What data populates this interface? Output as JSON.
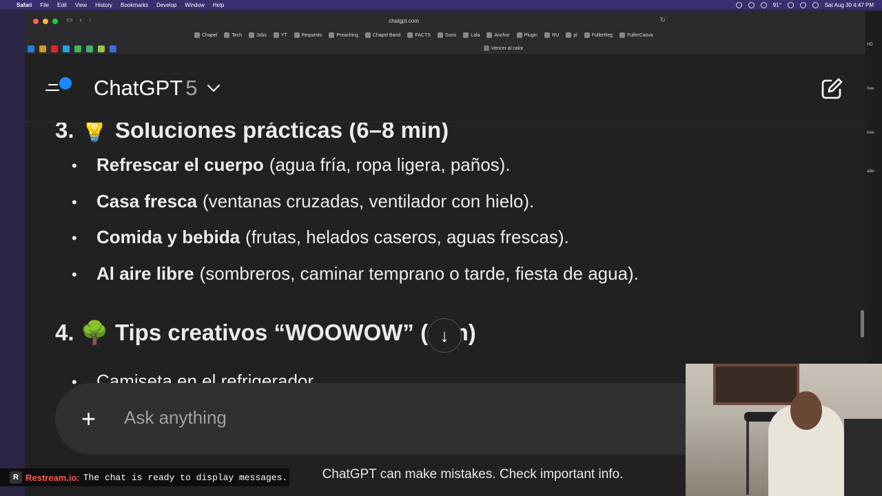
{
  "menubar": {
    "app": "Safari",
    "items": [
      "File",
      "Edit",
      "View",
      "History",
      "Bookmarks",
      "Develop",
      "Window",
      "Help"
    ],
    "temp": "91°",
    "datetime": "Sat Aug 30  4:47 PM"
  },
  "browser": {
    "url": "chatgpt.com",
    "favorites": [
      "Chapel",
      "Tech",
      "Jobs",
      "YT",
      "Requests",
      "Preaching",
      "Chapel Band",
      "FACTS",
      "Suno",
      "Lala",
      "Anchor",
      "Plugin",
      "RU",
      "pl",
      "FullerReg",
      "FullerCanva"
    ],
    "tab_title": "Vencer al calor"
  },
  "header": {
    "model_name": "ChatGPT",
    "model_version": "5",
    "chevron": "chevron-down-icon"
  },
  "content": {
    "section3_title": "3. 💡 Soluciones prácticas (6–8 min)",
    "section3_items": [
      {
        "bold": "Refrescar el cuerpo",
        "rest": "(agua fría, ropa ligera, paños)."
      },
      {
        "bold": "Casa fresca",
        "rest": "(ventanas cruzadas, ventilador con hielo)."
      },
      {
        "bold": "Comida y bebida",
        "rest": "(frutas, helados caseros, aguas frescas)."
      },
      {
        "bold": "Al aire libre",
        "rest": "(sombreros, caminar temprano o tarde, fiesta de agua)."
      }
    ],
    "section4_title": "4. 🌳 Tips creativos “WOOWOW” (",
    "section4_title_end": "min)",
    "section4_items": [
      "Camiseta en el refrigerador."
    ]
  },
  "composer": {
    "placeholder": "Ask anything"
  },
  "footer": {
    "disclaimer": "ChatGPT can make mistakes. Check important info."
  },
  "restream": {
    "logo_letter": "R",
    "brand": "Restream.io:",
    "message": "The chat is ready to display messages."
  },
  "right_strip": [
    "HD",
    "free",
    "free",
    "aller"
  ],
  "colors": {
    "accent_blue": "#1e88ff",
    "background": "#212121",
    "composer": "#303030"
  }
}
